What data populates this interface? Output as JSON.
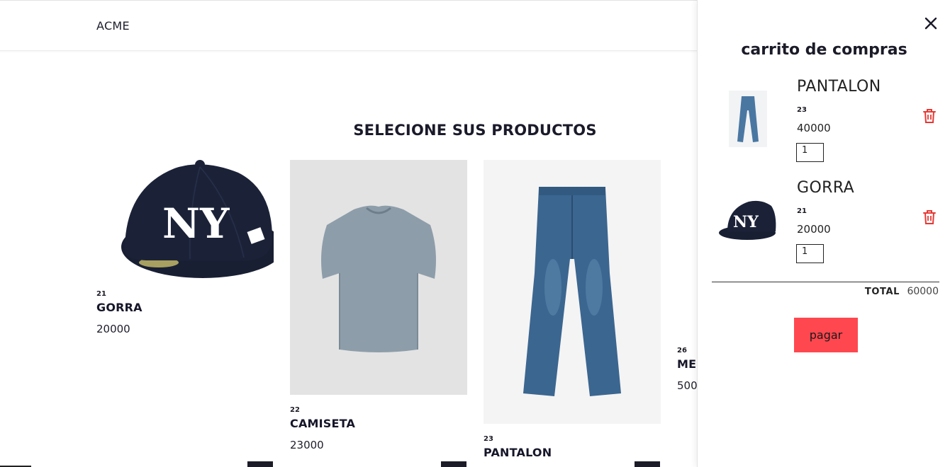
{
  "header": {
    "brand": "ACME"
  },
  "catalog": {
    "title": "SELECIONE SUS PRODUCTOS",
    "products": [
      {
        "id": "21",
        "name": "GORRA",
        "price": "20000"
      },
      {
        "id": "22",
        "name": "CAMISETA",
        "price": "23000"
      },
      {
        "id": "23",
        "name": "PANTALON",
        "price": ""
      },
      {
        "id": "26",
        "name": "MEI",
        "price": "500"
      }
    ]
  },
  "cart": {
    "title": "carrito de compras",
    "items": [
      {
        "name": "PANTALON",
        "id": "23",
        "price": "40000",
        "qty": "1"
      },
      {
        "name": "GORRA",
        "id": "21",
        "price": "20000",
        "qty": "1"
      }
    ],
    "total_label": "TOTAL",
    "total_value": "60000",
    "pay_label": "pagar"
  },
  "colors": {
    "accent": "#ff474f",
    "trash": "#e53935",
    "cap_navy": "#1b2238",
    "shirt": "#8e9daa",
    "jeans": "#3b6690"
  },
  "icons": {
    "close": "close-icon",
    "trash": "trash-icon"
  }
}
